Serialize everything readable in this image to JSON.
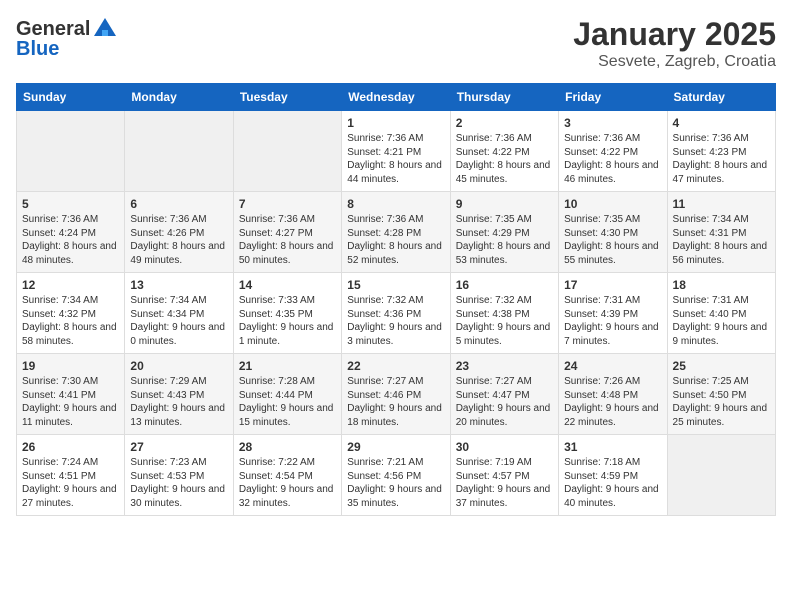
{
  "header": {
    "logo_general": "General",
    "logo_blue": "Blue",
    "month": "January 2025",
    "location": "Sesvete, Zagreb, Croatia"
  },
  "days_of_week": [
    "Sunday",
    "Monday",
    "Tuesday",
    "Wednesday",
    "Thursday",
    "Friday",
    "Saturday"
  ],
  "weeks": [
    [
      {
        "day": "",
        "sunrise": "",
        "sunset": "",
        "daylight": "",
        "empty": true
      },
      {
        "day": "",
        "sunrise": "",
        "sunset": "",
        "daylight": "",
        "empty": true
      },
      {
        "day": "",
        "sunrise": "",
        "sunset": "",
        "daylight": "",
        "empty": true
      },
      {
        "day": "1",
        "sunrise": "Sunrise: 7:36 AM",
        "sunset": "Sunset: 4:21 PM",
        "daylight": "Daylight: 8 hours and 44 minutes."
      },
      {
        "day": "2",
        "sunrise": "Sunrise: 7:36 AM",
        "sunset": "Sunset: 4:22 PM",
        "daylight": "Daylight: 8 hours and 45 minutes."
      },
      {
        "day": "3",
        "sunrise": "Sunrise: 7:36 AM",
        "sunset": "Sunset: 4:22 PM",
        "daylight": "Daylight: 8 hours and 46 minutes."
      },
      {
        "day": "4",
        "sunrise": "Sunrise: 7:36 AM",
        "sunset": "Sunset: 4:23 PM",
        "daylight": "Daylight: 8 hours and 47 minutes."
      }
    ],
    [
      {
        "day": "5",
        "sunrise": "Sunrise: 7:36 AM",
        "sunset": "Sunset: 4:24 PM",
        "daylight": "Daylight: 8 hours and 48 minutes."
      },
      {
        "day": "6",
        "sunrise": "Sunrise: 7:36 AM",
        "sunset": "Sunset: 4:26 PM",
        "daylight": "Daylight: 8 hours and 49 minutes."
      },
      {
        "day": "7",
        "sunrise": "Sunrise: 7:36 AM",
        "sunset": "Sunset: 4:27 PM",
        "daylight": "Daylight: 8 hours and 50 minutes."
      },
      {
        "day": "8",
        "sunrise": "Sunrise: 7:36 AM",
        "sunset": "Sunset: 4:28 PM",
        "daylight": "Daylight: 8 hours and 52 minutes."
      },
      {
        "day": "9",
        "sunrise": "Sunrise: 7:35 AM",
        "sunset": "Sunset: 4:29 PM",
        "daylight": "Daylight: 8 hours and 53 minutes."
      },
      {
        "day": "10",
        "sunrise": "Sunrise: 7:35 AM",
        "sunset": "Sunset: 4:30 PM",
        "daylight": "Daylight: 8 hours and 55 minutes."
      },
      {
        "day": "11",
        "sunrise": "Sunrise: 7:34 AM",
        "sunset": "Sunset: 4:31 PM",
        "daylight": "Daylight: 8 hours and 56 minutes."
      }
    ],
    [
      {
        "day": "12",
        "sunrise": "Sunrise: 7:34 AM",
        "sunset": "Sunset: 4:32 PM",
        "daylight": "Daylight: 8 hours and 58 minutes."
      },
      {
        "day": "13",
        "sunrise": "Sunrise: 7:34 AM",
        "sunset": "Sunset: 4:34 PM",
        "daylight": "Daylight: 9 hours and 0 minutes."
      },
      {
        "day": "14",
        "sunrise": "Sunrise: 7:33 AM",
        "sunset": "Sunset: 4:35 PM",
        "daylight": "Daylight: 9 hours and 1 minute."
      },
      {
        "day": "15",
        "sunrise": "Sunrise: 7:32 AM",
        "sunset": "Sunset: 4:36 PM",
        "daylight": "Daylight: 9 hours and 3 minutes."
      },
      {
        "day": "16",
        "sunrise": "Sunrise: 7:32 AM",
        "sunset": "Sunset: 4:38 PM",
        "daylight": "Daylight: 9 hours and 5 minutes."
      },
      {
        "day": "17",
        "sunrise": "Sunrise: 7:31 AM",
        "sunset": "Sunset: 4:39 PM",
        "daylight": "Daylight: 9 hours and 7 minutes."
      },
      {
        "day": "18",
        "sunrise": "Sunrise: 7:31 AM",
        "sunset": "Sunset: 4:40 PM",
        "daylight": "Daylight: 9 hours and 9 minutes."
      }
    ],
    [
      {
        "day": "19",
        "sunrise": "Sunrise: 7:30 AM",
        "sunset": "Sunset: 4:41 PM",
        "daylight": "Daylight: 9 hours and 11 minutes."
      },
      {
        "day": "20",
        "sunrise": "Sunrise: 7:29 AM",
        "sunset": "Sunset: 4:43 PM",
        "daylight": "Daylight: 9 hours and 13 minutes."
      },
      {
        "day": "21",
        "sunrise": "Sunrise: 7:28 AM",
        "sunset": "Sunset: 4:44 PM",
        "daylight": "Daylight: 9 hours and 15 minutes."
      },
      {
        "day": "22",
        "sunrise": "Sunrise: 7:27 AM",
        "sunset": "Sunset: 4:46 PM",
        "daylight": "Daylight: 9 hours and 18 minutes."
      },
      {
        "day": "23",
        "sunrise": "Sunrise: 7:27 AM",
        "sunset": "Sunset: 4:47 PM",
        "daylight": "Daylight: 9 hours and 20 minutes."
      },
      {
        "day": "24",
        "sunrise": "Sunrise: 7:26 AM",
        "sunset": "Sunset: 4:48 PM",
        "daylight": "Daylight: 9 hours and 22 minutes."
      },
      {
        "day": "25",
        "sunrise": "Sunrise: 7:25 AM",
        "sunset": "Sunset: 4:50 PM",
        "daylight": "Daylight: 9 hours and 25 minutes."
      }
    ],
    [
      {
        "day": "26",
        "sunrise": "Sunrise: 7:24 AM",
        "sunset": "Sunset: 4:51 PM",
        "daylight": "Daylight: 9 hours and 27 minutes."
      },
      {
        "day": "27",
        "sunrise": "Sunrise: 7:23 AM",
        "sunset": "Sunset: 4:53 PM",
        "daylight": "Daylight: 9 hours and 30 minutes."
      },
      {
        "day": "28",
        "sunrise": "Sunrise: 7:22 AM",
        "sunset": "Sunset: 4:54 PM",
        "daylight": "Daylight: 9 hours and 32 minutes."
      },
      {
        "day": "29",
        "sunrise": "Sunrise: 7:21 AM",
        "sunset": "Sunset: 4:56 PM",
        "daylight": "Daylight: 9 hours and 35 minutes."
      },
      {
        "day": "30",
        "sunrise": "Sunrise: 7:19 AM",
        "sunset": "Sunset: 4:57 PM",
        "daylight": "Daylight: 9 hours and 37 minutes."
      },
      {
        "day": "31",
        "sunrise": "Sunrise: 7:18 AM",
        "sunset": "Sunset: 4:59 PM",
        "daylight": "Daylight: 9 hours and 40 minutes."
      },
      {
        "day": "",
        "sunrise": "",
        "sunset": "",
        "daylight": "",
        "empty": true
      }
    ]
  ]
}
